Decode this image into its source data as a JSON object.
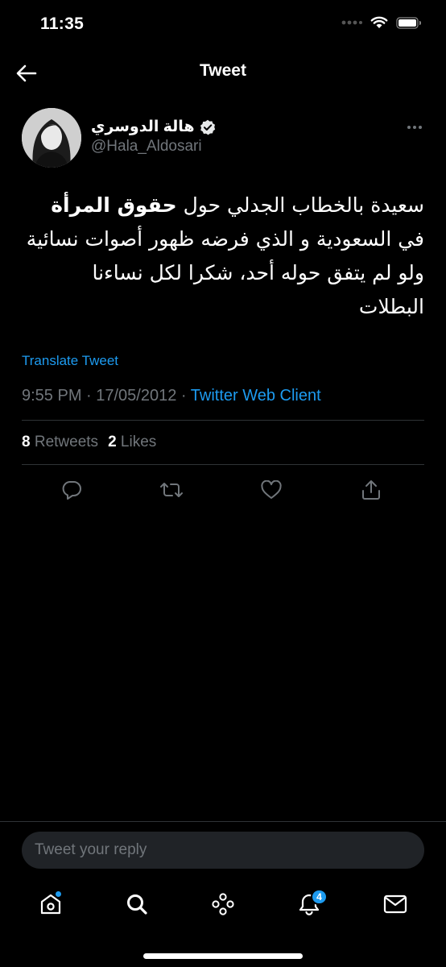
{
  "status_bar": {
    "time": "11:35"
  },
  "header": {
    "title": "Tweet"
  },
  "tweet": {
    "author": {
      "display_name": "هالة الدوسري",
      "handle": "@Hala_Aldosari",
      "verified": true
    },
    "text_parts": {
      "part1": "سعيدة بالخطاب الجدلي حول ",
      "bold": "حقوق المرأة",
      "part2": " في السعودية و الذي فرضه ظهور أصوات نسائية ولو لم يتفق حوله أحد، شكرا لكل نساءنا البطلات"
    },
    "translate_label": "Translate Tweet",
    "timestamp": "9:55 PM · 17/05/2012 · ",
    "client": "Twitter Web Client",
    "stats": {
      "retweets_count": "8",
      "retweets_label": "Retweets",
      "likes_count": "2",
      "likes_label": "Likes"
    },
    "actions": [
      "reply-icon",
      "retweet-icon",
      "like-icon",
      "share-icon"
    ]
  },
  "reply": {
    "placeholder": "Tweet your reply"
  },
  "tab_bar": {
    "items": [
      "home-icon",
      "search-icon",
      "spaces-icon",
      "notifications-icon",
      "messages-icon"
    ],
    "notifications_badge": "4"
  },
  "colors": {
    "accent": "#1d9bf0",
    "background": "#000000",
    "muted": "#71767b",
    "divider": "#2f3336"
  }
}
